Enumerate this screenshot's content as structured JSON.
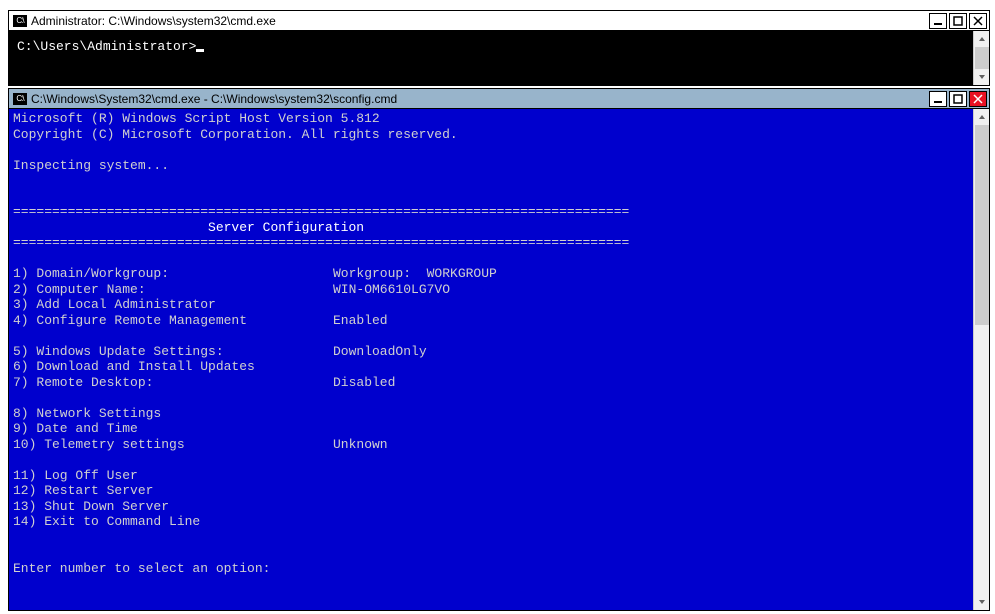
{
  "window1": {
    "title": "Administrator: C:\\Windows\\system32\\cmd.exe",
    "prompt": "C:\\Users\\Administrator>"
  },
  "window2": {
    "title": "C:\\Windows\\System32\\cmd.exe - C:\\Windows\\system32\\sconfig.cmd",
    "line1": "Microsoft (R) Windows Script Host Version 5.812",
    "line2": "Copyright (C) Microsoft Corporation. All rights reserved.",
    "line3": "Inspecting system...",
    "divider": "===============================================================================",
    "header": "                         Server Configuration",
    "options": {
      "o1": {
        "label": "1) Domain/Workgroup:",
        "value": "Workgroup:  WORKGROUP"
      },
      "o2": {
        "label": "2) Computer Name:",
        "value": "WIN-OM6610LG7VO"
      },
      "o3": {
        "label": "3) Add Local Administrator",
        "value": ""
      },
      "o4": {
        "label": "4) Configure Remote Management",
        "value": "Enabled"
      },
      "o5": {
        "label": "5) Windows Update Settings:",
        "value": "DownloadOnly"
      },
      "o6": {
        "label": "6) Download and Install Updates",
        "value": ""
      },
      "o7": {
        "label": "7) Remote Desktop:",
        "value": "Disabled"
      },
      "o8": {
        "label": "8) Network Settings",
        "value": ""
      },
      "o9": {
        "label": "9) Date and Time",
        "value": ""
      },
      "o10": {
        "label": "10) Telemetry settings",
        "value": "Unknown"
      },
      "o11": {
        "label": "11) Log Off User",
        "value": ""
      },
      "o12": {
        "label": "12) Restart Server",
        "value": ""
      },
      "o13": {
        "label": "13) Shut Down Server",
        "value": ""
      },
      "o14": {
        "label": "14) Exit to Command Line",
        "value": ""
      }
    },
    "prompt": "Enter number to select an option: "
  }
}
